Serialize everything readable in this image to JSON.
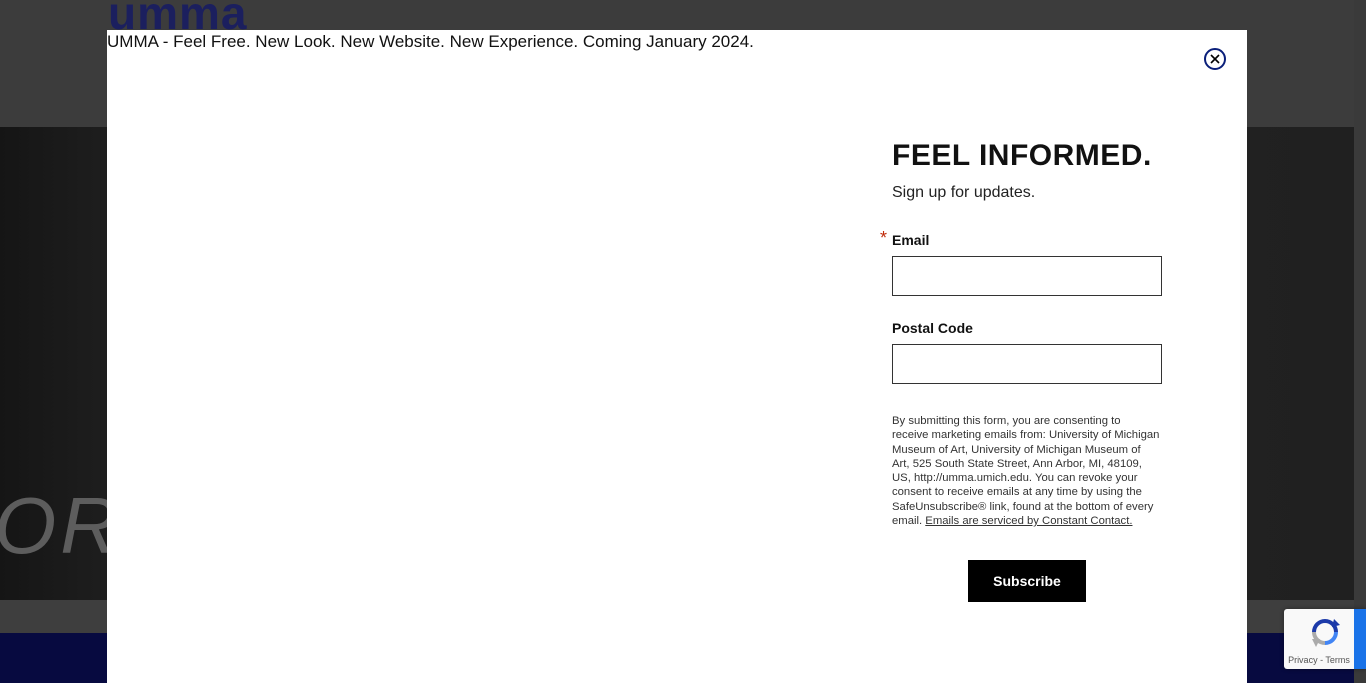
{
  "background": {
    "logo_text": "umma",
    "hero_text": "ORY"
  },
  "modal": {
    "banner": "UMMA - Feel Free. New Look. New Website. New Experience. Coming January 2024.",
    "close_icon": "close-x-icon",
    "form": {
      "title": "FEEL INFORMED.",
      "subtitle": "Sign up for updates.",
      "required_marker": "*",
      "email_label": "Email",
      "email_value": "",
      "postal_label": "Postal Code",
      "postal_value": "",
      "disclaimer": "By submitting this form, you are consenting to receive marketing emails from: University of Michigan Museum of Art, University of Michigan Museum of Art, 525 South State Street, Ann Arbor, MI, 48109, US, http://umma.umich.edu. You can revoke your consent to receive emails at any time by using the SafeUnsubscribe® link, found at the bottom of every email.",
      "disclaimer_link": "Emails are serviced by Constant Contact.",
      "subscribe_label": "Subscribe"
    }
  },
  "recaptcha": {
    "privacy": "Privacy",
    "separator": " - ",
    "terms": "Terms"
  },
  "colors": {
    "accent_blue": "#0a1f7a",
    "footer_navy": "#070a40",
    "required_red": "#c02b0a"
  }
}
